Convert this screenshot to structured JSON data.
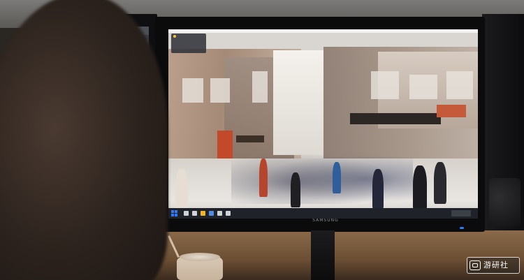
{
  "scene": {
    "monitor_brand": "SAMSUNG",
    "watermark": {
      "text": "游研社",
      "logo_icon": "controller-icon"
    },
    "left_monitor": {
      "title": "",
      "tab_label": ""
    },
    "street_view_overlay": {
      "line1": "",
      "line2": ""
    }
  },
  "colors": {
    "taskbar": "#1f2228",
    "start_accent": "#2d7cff",
    "shop_sign_red": "#c24a2b"
  }
}
